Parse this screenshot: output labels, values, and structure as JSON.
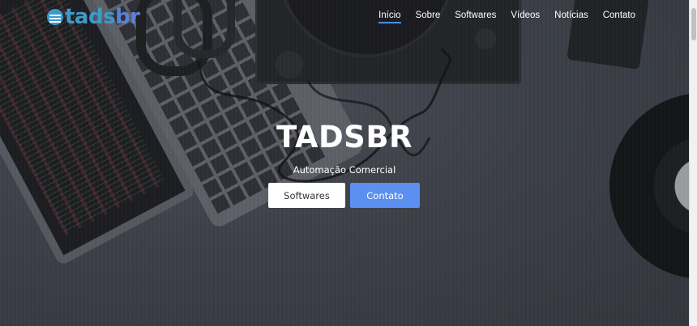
{
  "brand": {
    "part1": "tads",
    "part2": "br"
  },
  "nav": {
    "items": [
      {
        "label": "Início",
        "active": true
      },
      {
        "label": "Sobre"
      },
      {
        "label": "Softwares"
      },
      {
        "label": "Vídeos"
      },
      {
        "label": "Notícias"
      },
      {
        "label": "Contato"
      }
    ]
  },
  "hero": {
    "title": "TADSBR",
    "subtitle": "Automação Comercial",
    "buttons": {
      "primary_outline": "Softwares",
      "primary": "Contato"
    }
  },
  "colors": {
    "accent": "#5b8ff0",
    "brand_teal": "#3d9ac9",
    "brand_blue": "#5b82d6",
    "nav_underline": "#4c8ee8"
  }
}
